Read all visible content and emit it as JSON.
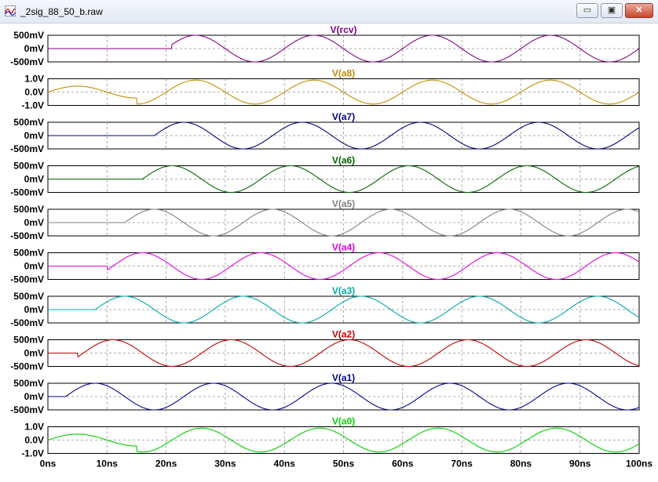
{
  "window": {
    "title": "_2sig_88_50_b.raw",
    "minimize_glyph": "▭",
    "restore_glyph": "▣",
    "close_glyph": "✕"
  },
  "chart_data": {
    "type": "line",
    "x_unit": "ns",
    "x_range": [
      0,
      100
    ],
    "x_ticks": [
      0,
      10,
      20,
      30,
      40,
      50,
      60,
      70,
      80,
      90,
      100
    ],
    "x_tick_labels": [
      "0ns",
      "10ns",
      "20ns",
      "30ns",
      "40ns",
      "50ns",
      "60ns",
      "70ns",
      "80ns",
      "90ns",
      "100ns"
    ],
    "grid": true,
    "panes": [
      {
        "name": "V(rcv)",
        "color": "#800080",
        "y_unit": "mV",
        "y_range": [
          -500,
          500
        ],
        "y_tick_labels": [
          "500mV",
          "0mV",
          "-500mV"
        ],
        "amplitude": 500,
        "period_ns": 20,
        "peak_ns": 25,
        "start_ns": 21,
        "pre_ripple": 0
      },
      {
        "name": "V(a8)",
        "color": "#bf8f00",
        "y_unit": "V",
        "y_range": [
          -1.0,
          1.0
        ],
        "y_tick_labels": [
          "1.0V",
          "0.0V",
          "-1.0V"
        ],
        "amplitude": 0.9,
        "period_ns": 20,
        "peak_ns": 25,
        "start_ns": 0,
        "early": {
          "until_ns": 15,
          "amplitude": 0.45,
          "peak_ns": 5
        }
      },
      {
        "name": "V(a7)",
        "color": "#000080",
        "y_unit": "mV",
        "y_range": [
          -500,
          500
        ],
        "y_tick_labels": [
          "500mV",
          "0mV",
          "-500mV"
        ],
        "amplitude": 500,
        "period_ns": 20,
        "peak_ns": 23,
        "start_ns": 18,
        "pre_ripple": 0
      },
      {
        "name": "V(a6)",
        "color": "#006400",
        "y_unit": "mV",
        "y_range": [
          -500,
          500
        ],
        "y_tick_labels": [
          "500mV",
          "0mV",
          "-500mV"
        ],
        "amplitude": 500,
        "period_ns": 20,
        "peak_ns": 21,
        "start_ns": 16,
        "pre_ripple": 0
      },
      {
        "name": "V(a5)",
        "color": "#808080",
        "y_unit": "mV",
        "y_range": [
          -500,
          500
        ],
        "y_tick_labels": [
          "500mV",
          "0mV",
          "-500mV"
        ],
        "amplitude": 500,
        "period_ns": 20,
        "peak_ns": 18,
        "start_ns": 13,
        "pre_ripple": 0
      },
      {
        "name": "V(a4)",
        "color": "#e000e0",
        "y_unit": "mV",
        "y_range": [
          -500,
          500
        ],
        "y_tick_labels": [
          "500mV",
          "0mV",
          "-500mV"
        ],
        "amplitude": 500,
        "period_ns": 20,
        "peak_ns": 16,
        "start_ns": 10,
        "pre_ripple": 0
      },
      {
        "name": "V(a3)",
        "color": "#00a8a8",
        "y_unit": "mV",
        "y_range": [
          -500,
          500
        ],
        "y_tick_labels": [
          "500mV",
          "0mV",
          "-500mV"
        ],
        "amplitude": 500,
        "period_ns": 20,
        "peak_ns": 13,
        "start_ns": 8,
        "pre_ripple": 0
      },
      {
        "name": "V(a2)",
        "color": "#c00000",
        "y_unit": "mV",
        "y_range": [
          -500,
          500
        ],
        "y_tick_labels": [
          "500mV",
          "0mV",
          "-500mV"
        ],
        "amplitude": 500,
        "period_ns": 20,
        "peak_ns": 11,
        "start_ns": 5,
        "pre_ripple": 0
      },
      {
        "name": "V(a1)",
        "color": "#000090",
        "y_unit": "mV",
        "y_range": [
          -500,
          500
        ],
        "y_tick_labels": [
          "500mV",
          "0mV",
          "-500mV"
        ],
        "amplitude": 500,
        "period_ns": 20,
        "peak_ns": 8,
        "start_ns": 3,
        "pre_ripple": 0
      },
      {
        "name": "V(a0)",
        "color": "#00d000",
        "y_unit": "V",
        "y_range": [
          -1.0,
          1.0
        ],
        "y_tick_labels": [
          "1.0V",
          "0.0V",
          "-1.0V"
        ],
        "amplitude": 0.9,
        "period_ns": 20,
        "peak_ns": 26,
        "start_ns": 0,
        "early": {
          "until_ns": 15,
          "amplitude": 0.45,
          "peak_ns": 5
        }
      }
    ]
  }
}
